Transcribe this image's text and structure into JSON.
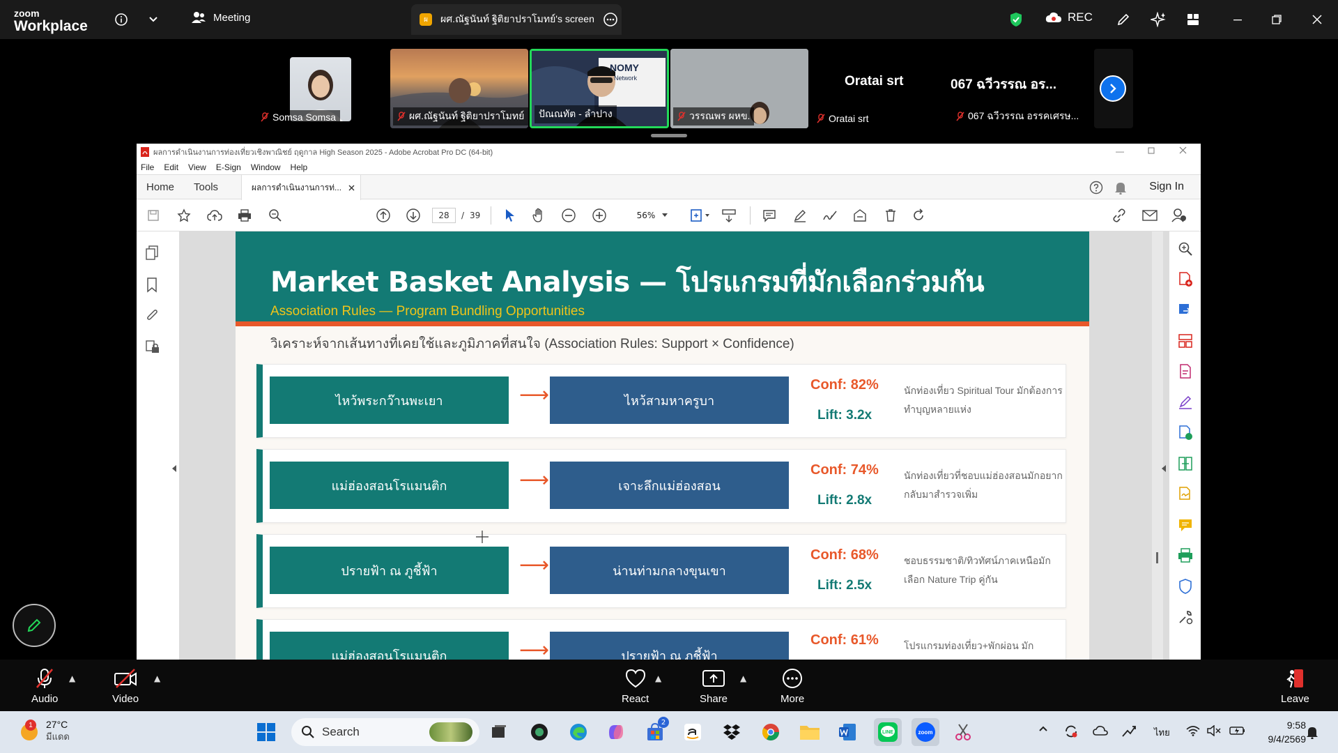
{
  "zoom": {
    "logo_top": "zoom",
    "logo_bottom": "Workplace",
    "meeting_label": "Meeting",
    "share_tab_badge": "ผ",
    "share_tab_label": "ผศ.ณัฐนันท์ ฐิติยาปราโมทย์'s screen",
    "rec_label": "REC"
  },
  "participants": [
    {
      "name": "Somsa Somsa",
      "muted": true
    },
    {
      "name": "ผศ.ณัฐนันท์ ฐิติยาปราโมทย์",
      "muted": true
    },
    {
      "name": "ปัณณทัต - ลำปาง",
      "muted": false,
      "active_speaker": true
    },
    {
      "name": "วรรณพร ผหข.",
      "muted": true
    },
    {
      "name": "Oratai srt",
      "display": "Oratai srt",
      "muted": true
    },
    {
      "name": "067 ฉวีวรรณ อรรคเศรษ...",
      "display": "067 ฉวีวรรณ อร...",
      "muted": true
    }
  ],
  "tile_text": {
    "video_banner_1": "NOMY",
    "video_banner_2": "Network"
  },
  "acrobat": {
    "window_title": "ผลการดำเนินงานการท่องเที่ยวเชิงพาณิชย์ ฤดูกาล High Season 2025 - Adobe Acrobat Pro DC (64-bit)",
    "menu": [
      "File",
      "Edit",
      "View",
      "E-Sign",
      "Window",
      "Help"
    ],
    "tabs": [
      "Home",
      "Tools"
    ],
    "doc_tab": "ผลการดำเนินงานการท่...",
    "sign_in": "Sign In",
    "page_current": "28",
    "page_total": "39",
    "page_sep": "/",
    "zoom_level": "56%"
  },
  "slide": {
    "title": "Market Basket Analysis — โปรแกรมที่มักเลือกร่วมกัน",
    "subtitle": "Association Rules — Program Bundling Opportunities",
    "lead": "วิเคราะห์จากเส้นทางที่เคยใช้และภูมิภาคที่สนใจ (Association Rules: Support × Confidence)",
    "arrow": "⟶",
    "rules": [
      {
        "from": "ไหว้พระกว๊านพะเยา",
        "to": "ไหว้สามหาครูบา",
        "conf": "Conf: 82%",
        "lift": "Lift: 3.2x",
        "note": "นักท่องเที่ยว Spiritual Tour มักต้องการทำบุญหลายแห่ง"
      },
      {
        "from": "แม่ฮ่องสอนโรแมนติก",
        "to": "เจาะลึกแม่ฮ่องสอน",
        "conf": "Conf: 74%",
        "lift": "Lift: 2.8x",
        "note": "นักท่องเที่ยวที่ชอบแม่ฮ่องสอนมักอยากกลับมาสำรวจเพิ่ม"
      },
      {
        "from": "ปรายฟ้า ณ ภูชี้ฟ้า",
        "to": "น่านท่ามกลางขุนเขา",
        "conf": "Conf: 68%",
        "lift": "Lift: 2.5x",
        "note": "ชอบธรรมชาติ/ทิวทัศน์ภาคเหนือมักเลือก Nature Trip คู่กัน"
      },
      {
        "from": "แม่ฮ่องสอนโรแมนติก",
        "to": "ปรายฟ้า ณ ภูชี้ฟ้า",
        "conf": "Conf: 61%",
        "lift": "",
        "note": "โปรแกรมท่องเที่ยว+พักผ่อน มัก"
      }
    ]
  },
  "controls": {
    "audio": "Audio",
    "video": "Video",
    "react": "React",
    "share": "Share",
    "more": "More",
    "leave": "Leave"
  },
  "taskbar": {
    "temperature": "27°C",
    "weather": "มีแดด",
    "weather_badge": "1",
    "search": "Search",
    "store_badge": "2",
    "language": "ไทย",
    "time": "9:58",
    "date": "9/4/2569"
  },
  "colors": {
    "slide_teal": "#137a74",
    "slide_blue": "#2e5d8c",
    "slide_orange": "#e8582a",
    "slide_yellow": "#f0c419",
    "zoom_accent": "#0e72ed",
    "active_speaker": "#23d959"
  }
}
